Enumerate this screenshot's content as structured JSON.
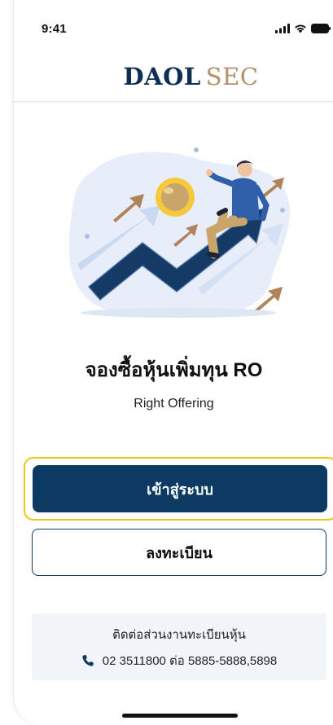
{
  "status_bar": {
    "time": "9:41"
  },
  "header": {
    "logo_primary": "DAOL",
    "logo_secondary": "SEC"
  },
  "main": {
    "title": "จองซื้อหุ้นเพิ่มทุน RO",
    "subtitle": "Right Offering"
  },
  "actions": {
    "login_label": "เข้าสู่ระบบ",
    "register_label": "ลงทะเบียน"
  },
  "contact": {
    "label": "ติดต่อส่วนงานทะเบียนหุ้น",
    "phone": "02 3511800 ต่อ 5885-5888,5898",
    "icon": "phone-icon"
  },
  "colors": {
    "primary": "#0d3a63",
    "brand_gold": "#b39069",
    "focus": "#f2c416",
    "contact_bg": "#f1f4f9"
  }
}
